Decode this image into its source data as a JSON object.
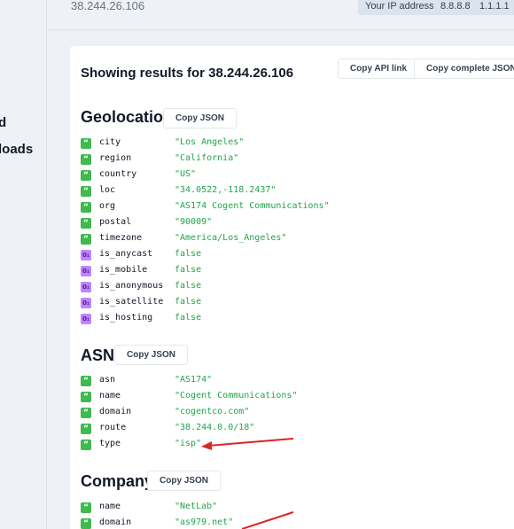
{
  "sidebar": {
    "items": [
      {
        "label": "d"
      },
      {
        "label": "loads"
      }
    ]
  },
  "topbar": {
    "ip_value": "38.244.26.106",
    "pills": [
      "Your IP address",
      "8.8.8.8",
      "1.1.1.1"
    ]
  },
  "card": {
    "title": "Showing results for 38.244.26.106",
    "copy_api_link": "Copy API link",
    "copy_complete_json": "Copy complete JSON"
  },
  "geolocation": {
    "title": "Geolocation",
    "copy_label": "Copy JSON",
    "rows": [
      {
        "type": "string",
        "key": "city",
        "value": "\"Los Angeles\""
      },
      {
        "type": "string",
        "key": "region",
        "value": "\"California\""
      },
      {
        "type": "string",
        "key": "country",
        "value": "\"US\""
      },
      {
        "type": "string",
        "key": "loc",
        "value": "\"34.0522,-118.2437\""
      },
      {
        "type": "string",
        "key": "org",
        "value": "\"AS174 Cogent Communications\""
      },
      {
        "type": "string",
        "key": "postal",
        "value": "\"90009\""
      },
      {
        "type": "string",
        "key": "timezone",
        "value": "\"America/Los_Angeles\""
      },
      {
        "type": "boolean",
        "key": "is_anycast",
        "value": "false"
      },
      {
        "type": "boolean",
        "key": "is_mobile",
        "value": "false"
      },
      {
        "type": "boolean",
        "key": "is_anonymous",
        "value": "false"
      },
      {
        "type": "boolean",
        "key": "is_satellite",
        "value": "false"
      },
      {
        "type": "boolean",
        "key": "is_hosting",
        "value": "false"
      }
    ]
  },
  "asn": {
    "title": "ASN",
    "copy_label": "Copy JSON",
    "rows": [
      {
        "type": "string",
        "key": "asn",
        "value": "\"AS174\""
      },
      {
        "type": "string",
        "key": "name",
        "value": "\"Cogent Communications\""
      },
      {
        "type": "string",
        "key": "domain",
        "value": "\"cogentco.com\""
      },
      {
        "type": "string",
        "key": "route",
        "value": "\"38.244.0.0/18\""
      },
      {
        "type": "string",
        "key": "type",
        "value": "\"isp\""
      }
    ]
  },
  "company": {
    "title": "Company",
    "copy_label": "Copy JSON",
    "rows": [
      {
        "type": "string",
        "key": "name",
        "value": "\"NetLab\""
      },
      {
        "type": "string",
        "key": "domain",
        "value": "\"as979.net\""
      }
    ]
  },
  "icons": {
    "string_icon": "quote-icon",
    "boolean_icon": "toggle-icon"
  },
  "colors": {
    "string_value": "#22a44a",
    "string_icon_bg": "#3fb950",
    "boolean_icon_bg": "#c084fc",
    "annotation_arrow": "#dc2626"
  }
}
